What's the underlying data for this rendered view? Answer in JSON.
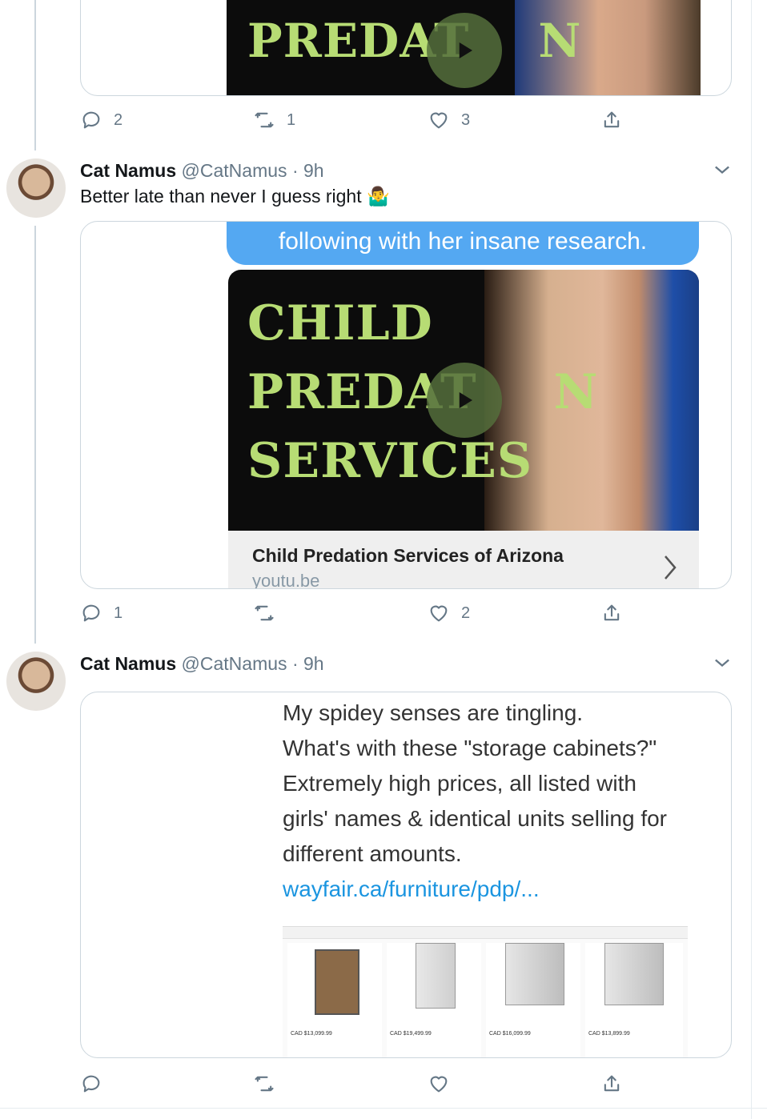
{
  "colors": {
    "border": "#ccd6dd",
    "icon": "#657786",
    "link": "#1b95e0",
    "stencil_green": "#b7dc74"
  },
  "tweet0": {
    "video_line1": "PREDAT",
    "video_line1_end": "N",
    "actions": {
      "reply_count": "2",
      "retweet_count": "1",
      "like_count": "3"
    }
  },
  "tweet1": {
    "name": "Cat Namus",
    "handle": "@CatNamus",
    "time": "· 9h",
    "text": "Better late than never I guess right",
    "emoji": "🤷‍♂️",
    "image_caption": "following with her insane research.",
    "video_lines": [
      "CHILD",
      "PREDAT",
      "N",
      "SERVICES"
    ],
    "link_title": "Child Predation Services of Arizona",
    "link_domain": "youtu.be",
    "actions": {
      "reply_count": "1",
      "retweet_count": "",
      "like_count": "2"
    }
  },
  "tweet2": {
    "name": "Cat Namus",
    "handle": "@CatNamus",
    "time": "· 9h",
    "image_text": [
      "My spidey senses are tingling.",
      "What's with these \"storage cabinets?\"",
      "Extremely high prices, all listed with",
      "girls' names & identical units selling for",
      "different amounts."
    ],
    "image_link": "wayfair.ca/furniture/pdp/...",
    "products": [
      {
        "price": "CAD $13,099.99"
      },
      {
        "price": "CAD $19,499.99"
      },
      {
        "price": "CAD $16,099.99"
      },
      {
        "price": "CAD $13,899.99"
      }
    ],
    "actions": {
      "reply_count": "",
      "retweet_count": "",
      "like_count": ""
    }
  },
  "icons": [
    "reply-icon",
    "retweet-icon",
    "like-icon",
    "share-icon",
    "chevron-down-icon",
    "play-icon"
  ]
}
